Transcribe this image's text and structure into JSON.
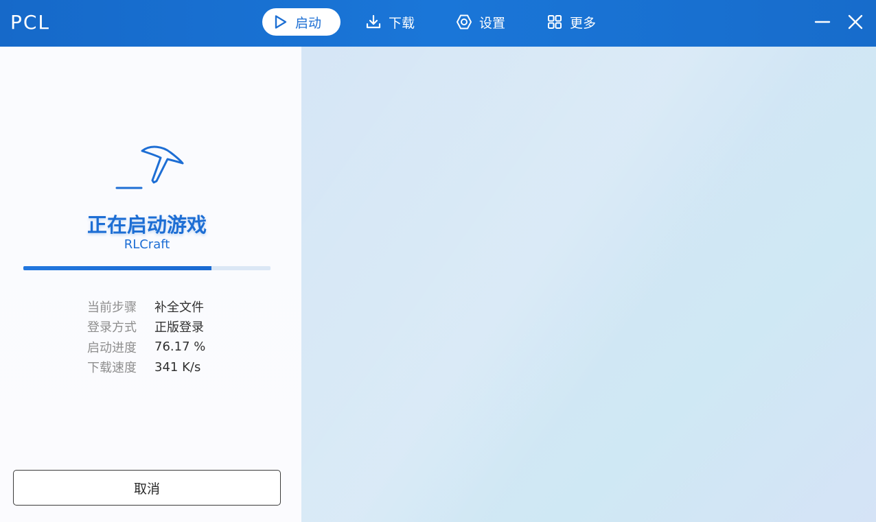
{
  "app": {
    "title": "PCL"
  },
  "nav": [
    {
      "label": "启动",
      "icon": "play-icon",
      "active": true
    },
    {
      "label": "下载",
      "icon": "download-icon",
      "active": false
    },
    {
      "label": "设置",
      "icon": "settings-icon",
      "active": false
    },
    {
      "label": "更多",
      "icon": "grid-icon",
      "active": false
    }
  ],
  "window_controls": {
    "minimize_icon": "minimize-icon",
    "close_icon": "close-icon"
  },
  "launch": {
    "status_title": "正在启动游戏",
    "instance_name": "RLCraft",
    "progress": 0.7617,
    "details": [
      {
        "label": "当前步骤",
        "value": "补全文件"
      },
      {
        "label": "登录方式",
        "value": "正版登录"
      },
      {
        "label": "启动进度",
        "value": "76.17 %"
      },
      {
        "label": "下载速度",
        "value": "341 K/s"
      }
    ],
    "cancel_label": "取消"
  },
  "colors": {
    "titlebar": "#1a70d2",
    "accent": "#1d6ed4",
    "panel_bg": "#fafbfe",
    "content_bg": "#d4e6f6"
  }
}
